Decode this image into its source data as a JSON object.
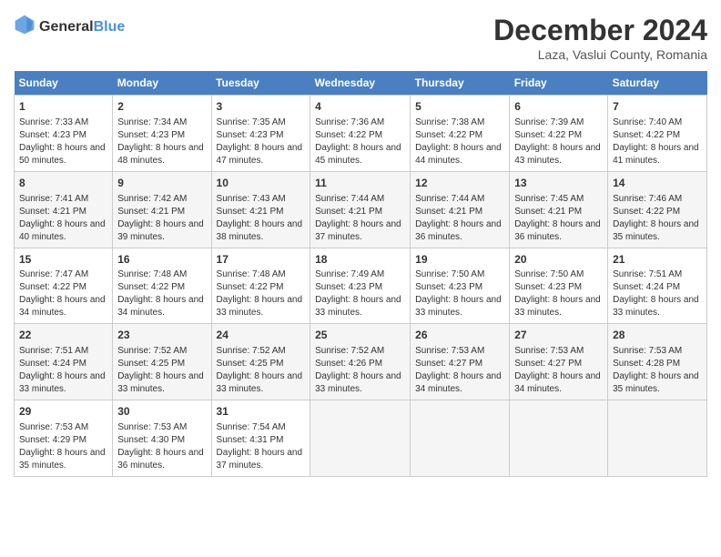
{
  "logo": {
    "general": "General",
    "blue": "Blue"
  },
  "title": "December 2024",
  "subtitle": "Laza, Vaslui County, Romania",
  "days_header": [
    "Sunday",
    "Monday",
    "Tuesday",
    "Wednesday",
    "Thursday",
    "Friday",
    "Saturday"
  ],
  "weeks": [
    [
      {
        "day": "1",
        "sunrise": "7:33 AM",
        "sunset": "4:23 PM",
        "daylight": "8 hours and 50 minutes."
      },
      {
        "day": "2",
        "sunrise": "7:34 AM",
        "sunset": "4:23 PM",
        "daylight": "8 hours and 48 minutes."
      },
      {
        "day": "3",
        "sunrise": "7:35 AM",
        "sunset": "4:23 PM",
        "daylight": "8 hours and 47 minutes."
      },
      {
        "day": "4",
        "sunrise": "7:36 AM",
        "sunset": "4:22 PM",
        "daylight": "8 hours and 45 minutes."
      },
      {
        "day": "5",
        "sunrise": "7:38 AM",
        "sunset": "4:22 PM",
        "daylight": "8 hours and 44 minutes."
      },
      {
        "day": "6",
        "sunrise": "7:39 AM",
        "sunset": "4:22 PM",
        "daylight": "8 hours and 43 minutes."
      },
      {
        "day": "7",
        "sunrise": "7:40 AM",
        "sunset": "4:22 PM",
        "daylight": "8 hours and 41 minutes."
      }
    ],
    [
      {
        "day": "8",
        "sunrise": "7:41 AM",
        "sunset": "4:21 PM",
        "daylight": "8 hours and 40 minutes."
      },
      {
        "day": "9",
        "sunrise": "7:42 AM",
        "sunset": "4:21 PM",
        "daylight": "8 hours and 39 minutes."
      },
      {
        "day": "10",
        "sunrise": "7:43 AM",
        "sunset": "4:21 PM",
        "daylight": "8 hours and 38 minutes."
      },
      {
        "day": "11",
        "sunrise": "7:44 AM",
        "sunset": "4:21 PM",
        "daylight": "8 hours and 37 minutes."
      },
      {
        "day": "12",
        "sunrise": "7:44 AM",
        "sunset": "4:21 PM",
        "daylight": "8 hours and 36 minutes."
      },
      {
        "day": "13",
        "sunrise": "7:45 AM",
        "sunset": "4:21 PM",
        "daylight": "8 hours and 36 minutes."
      },
      {
        "day": "14",
        "sunrise": "7:46 AM",
        "sunset": "4:22 PM",
        "daylight": "8 hours and 35 minutes."
      }
    ],
    [
      {
        "day": "15",
        "sunrise": "7:47 AM",
        "sunset": "4:22 PM",
        "daylight": "8 hours and 34 minutes."
      },
      {
        "day": "16",
        "sunrise": "7:48 AM",
        "sunset": "4:22 PM",
        "daylight": "8 hours and 34 minutes."
      },
      {
        "day": "17",
        "sunrise": "7:48 AM",
        "sunset": "4:22 PM",
        "daylight": "8 hours and 33 minutes."
      },
      {
        "day": "18",
        "sunrise": "7:49 AM",
        "sunset": "4:23 PM",
        "daylight": "8 hours and 33 minutes."
      },
      {
        "day": "19",
        "sunrise": "7:50 AM",
        "sunset": "4:23 PM",
        "daylight": "8 hours and 33 minutes."
      },
      {
        "day": "20",
        "sunrise": "7:50 AM",
        "sunset": "4:23 PM",
        "daylight": "8 hours and 33 minutes."
      },
      {
        "day": "21",
        "sunrise": "7:51 AM",
        "sunset": "4:24 PM",
        "daylight": "8 hours and 33 minutes."
      }
    ],
    [
      {
        "day": "22",
        "sunrise": "7:51 AM",
        "sunset": "4:24 PM",
        "daylight": "8 hours and 33 minutes."
      },
      {
        "day": "23",
        "sunrise": "7:52 AM",
        "sunset": "4:25 PM",
        "daylight": "8 hours and 33 minutes."
      },
      {
        "day": "24",
        "sunrise": "7:52 AM",
        "sunset": "4:25 PM",
        "daylight": "8 hours and 33 minutes."
      },
      {
        "day": "25",
        "sunrise": "7:52 AM",
        "sunset": "4:26 PM",
        "daylight": "8 hours and 33 minutes."
      },
      {
        "day": "26",
        "sunrise": "7:53 AM",
        "sunset": "4:27 PM",
        "daylight": "8 hours and 34 minutes."
      },
      {
        "day": "27",
        "sunrise": "7:53 AM",
        "sunset": "4:27 PM",
        "daylight": "8 hours and 34 minutes."
      },
      {
        "day": "28",
        "sunrise": "7:53 AM",
        "sunset": "4:28 PM",
        "daylight": "8 hours and 35 minutes."
      }
    ],
    [
      {
        "day": "29",
        "sunrise": "7:53 AM",
        "sunset": "4:29 PM",
        "daylight": "8 hours and 35 minutes."
      },
      {
        "day": "30",
        "sunrise": "7:53 AM",
        "sunset": "4:30 PM",
        "daylight": "8 hours and 36 minutes."
      },
      {
        "day": "31",
        "sunrise": "7:54 AM",
        "sunset": "4:31 PM",
        "daylight": "8 hours and 37 minutes."
      },
      null,
      null,
      null,
      null
    ]
  ]
}
